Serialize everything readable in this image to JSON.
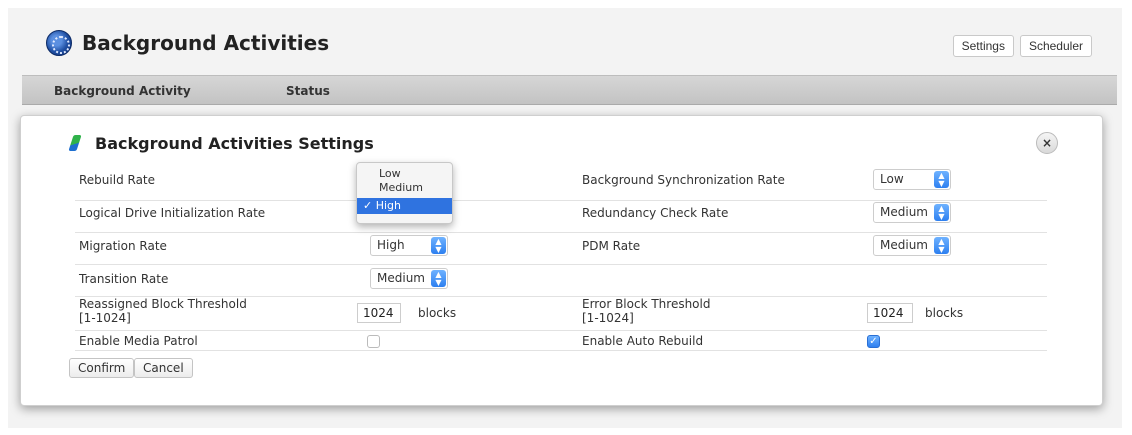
{
  "app": {
    "title": "Background Activities"
  },
  "header_buttons": {
    "settings": "Settings",
    "scheduler": "Scheduler"
  },
  "table": {
    "columns": [
      "Background Activity",
      "Status"
    ]
  },
  "modal": {
    "title": "Background Activities Settings",
    "close_label": "×",
    "fields": {
      "rebuild_rate": {
        "label": "Rebuild Rate"
      },
      "logical_drive_init_rate": {
        "label": "Logical Drive Initialization Rate"
      },
      "migration_rate": {
        "label": "Migration Rate",
        "value": "High"
      },
      "transition_rate": {
        "label": "Transition Rate",
        "value": "Medium"
      },
      "reassigned_block_threshold": {
        "label": "Reassigned Block Threshold",
        "range": "[1-1024]",
        "value": "1024",
        "unit": "blocks"
      },
      "enable_media_patrol": {
        "label": "Enable Media Patrol",
        "checked": false
      },
      "background_sync_rate": {
        "label": "Background Synchronization Rate",
        "value": "Low"
      },
      "redundancy_check_rate": {
        "label": "Redundancy Check Rate",
        "value": "Medium"
      },
      "pdm_rate": {
        "label": "PDM Rate",
        "value": "Medium"
      },
      "error_block_threshold": {
        "label": "Error Block Threshold",
        "range": "[1-1024]",
        "value": "1024",
        "unit": "blocks"
      },
      "enable_auto_rebuild": {
        "label": "Enable Auto Rebuild",
        "checked": true
      }
    },
    "dropdown": {
      "options": [
        "Low",
        "Medium",
        "High"
      ],
      "selected": "High",
      "check_mark": "✓"
    },
    "buttons": {
      "confirm": "Confirm",
      "cancel": "Cancel"
    }
  },
  "colors": {
    "accent": "#2f73e0",
    "header_bar": "#c8c8c8"
  },
  "icons": [
    "app-logo-icon",
    "settings-pencil-icon",
    "close-icon",
    "select-arrows-icon",
    "checkmark-icon"
  ]
}
